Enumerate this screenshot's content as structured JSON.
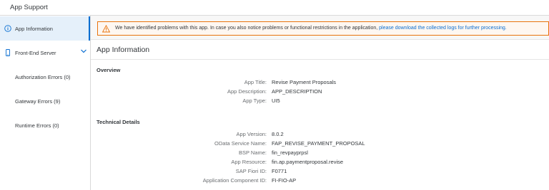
{
  "window": {
    "title": "App Support"
  },
  "sidebar": {
    "items": [
      {
        "label": "App Information",
        "icon": "info-icon"
      },
      {
        "label": "Front-End Server",
        "icon": "phone-icon"
      },
      {
        "label": "Authorization Errors (0)"
      },
      {
        "label": "Gateway Errors (9)"
      },
      {
        "label": "Runtime Errors (0)"
      }
    ]
  },
  "banner": {
    "text": "We have identified problems with this app. In case you also notice problems or functional restrictions in the application,",
    "link": "please download the collected logs for further processing."
  },
  "main": {
    "title": "App Information",
    "overview": {
      "heading": "Overview",
      "rows": [
        {
          "label": "App Title:",
          "value": "Revise Payment Proposals"
        },
        {
          "label": "App Description:",
          "value": "APP_DESCRIPTION"
        },
        {
          "label": "App Type:",
          "value": "UI5"
        }
      ]
    },
    "technical": {
      "heading": "Technical Details",
      "rows": [
        {
          "label": "App Version:",
          "value": "8.0.2"
        },
        {
          "label": "OData Service Name:",
          "value": "FAP_REVISE_PAYMENT_PROPOSAL"
        },
        {
          "label": "BSP Name:",
          "value": "fin_revpayprpsl"
        },
        {
          "label": "App Resource:",
          "value": "fin.ap.paymentproposal.revise"
        },
        {
          "label": "SAP Fiori ID:",
          "value": "F0771"
        },
        {
          "label": "Application Component ID:",
          "value": "FI-FIO-AP"
        }
      ]
    }
  },
  "colors": {
    "accent": "#0a6ed1",
    "warning": "#e9730c",
    "selected_bg": "#e5f0fa"
  }
}
